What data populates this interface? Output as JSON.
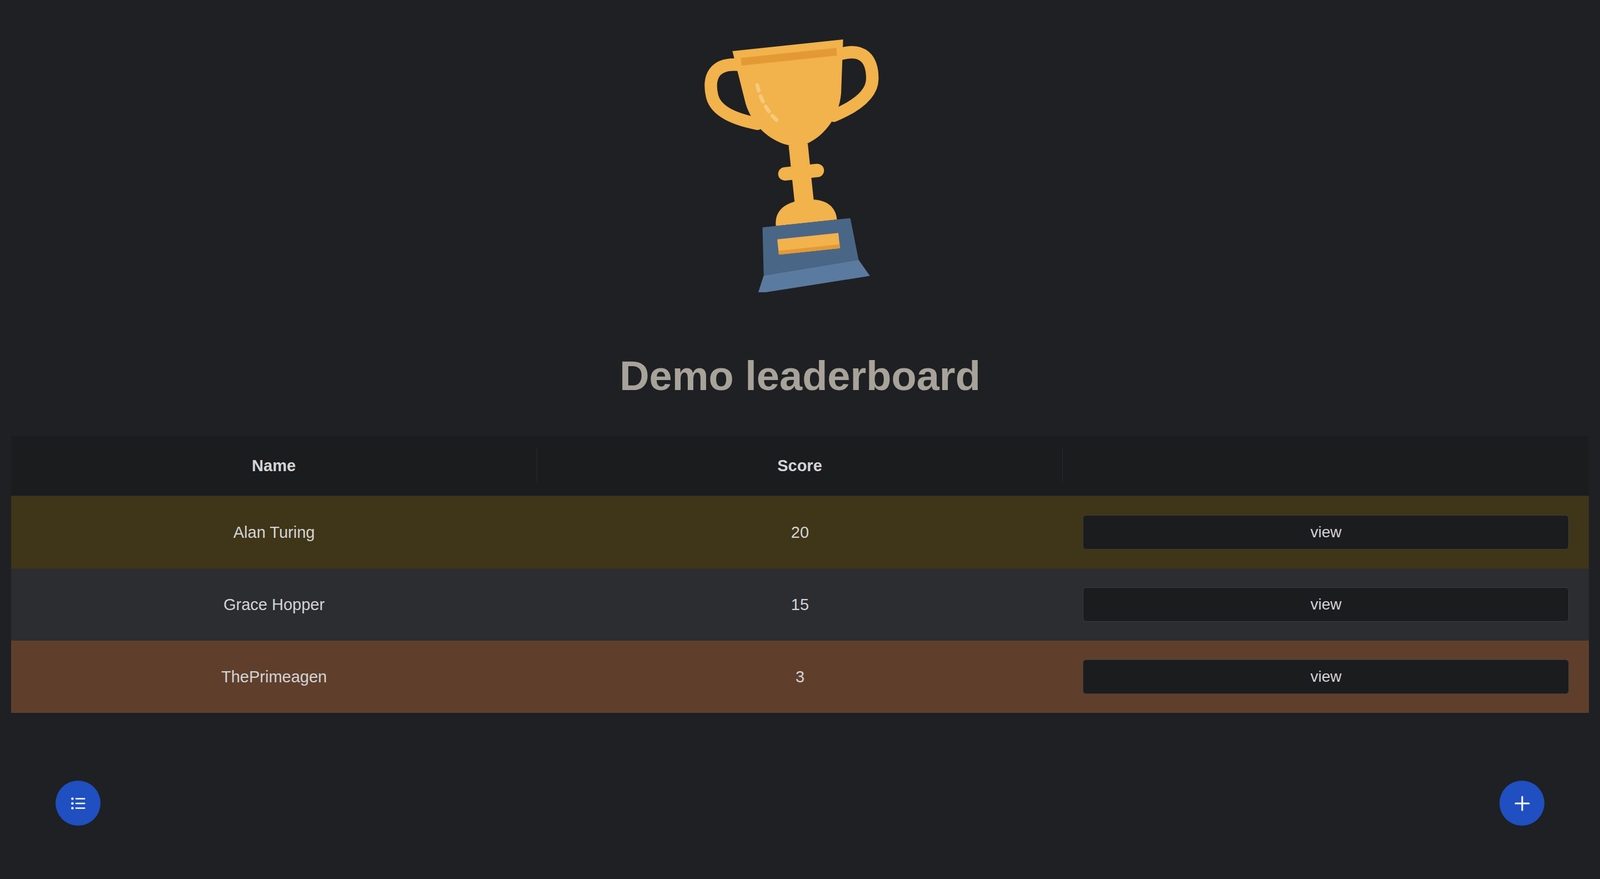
{
  "title": "Demo leaderboard",
  "table": {
    "columns": [
      "Name",
      "Score",
      ""
    ],
    "rows": [
      {
        "name": "Alan Turing",
        "score": "20",
        "action": "view",
        "color": "#3f3518"
      },
      {
        "name": "Grace Hopper",
        "score": "15",
        "action": "view",
        "color": "#2c2d30"
      },
      {
        "name": "ThePrimeagen",
        "score": "3",
        "action": "view",
        "color": "#5f3f2c"
      }
    ]
  }
}
